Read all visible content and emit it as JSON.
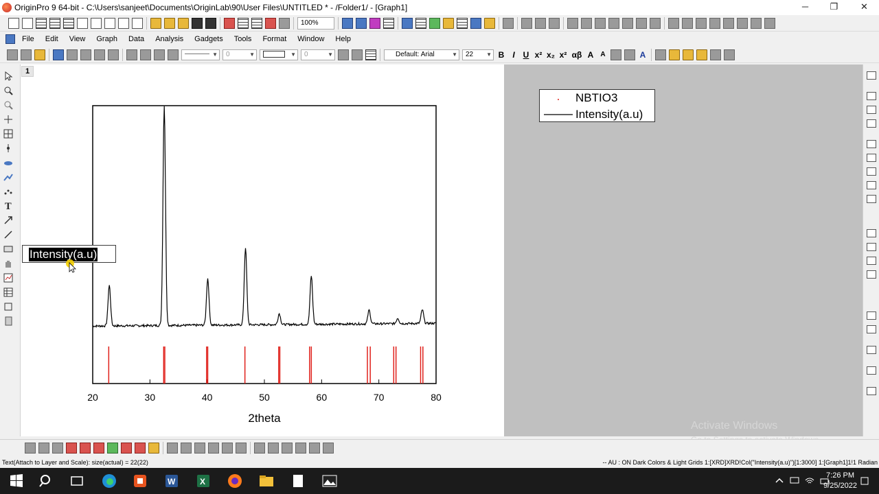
{
  "window": {
    "title": "OriginPro 9 64-bit - C:\\Users\\sanjeet\\Documents\\OriginLab\\90\\User Files\\UNTITLED * - /Folder1/ - [Graph1]",
    "minimize": "─",
    "maximize": "❐",
    "close": "✕"
  },
  "toolbar": {
    "zoom": "100%"
  },
  "menu": [
    "File",
    "Edit",
    "View",
    "Graph",
    "Data",
    "Analysis",
    "Gadgets",
    "Tools",
    "Format",
    "Window",
    "Help"
  ],
  "format_toolbar": {
    "line_width": "0",
    "fill_width": "0",
    "font": "Default: Arial",
    "font_size": "22",
    "bold": "B",
    "italic": "I",
    "underline": "U",
    "greek": "αβ"
  },
  "graph": {
    "layer": "1",
    "y_label_text": "Intensity(a.u)",
    "legend": {
      "entries": [
        "NBTIO3",
        "Intensity(a.u)"
      ]
    }
  },
  "chart_data": {
    "type": "line",
    "xlabel": "2theta",
    "ylabel": "Intensity(a.u)",
    "xlim": [
      20,
      80
    ],
    "xticks": [
      "20",
      "30",
      "40",
      "50",
      "60",
      "70",
      "80"
    ],
    "series": [
      {
        "name": "Intensity(a.u)",
        "color": "#000000",
        "peaks": [
          {
            "x": 22.9,
            "height": 0.148
          },
          {
            "x": 32.5,
            "height": 0.8
          },
          {
            "x": 40.1,
            "height": 0.17
          },
          {
            "x": 46.7,
            "height": 0.282
          },
          {
            "x": 52.6,
            "height": 0.04
          },
          {
            "x": 58.2,
            "height": 0.177
          },
          {
            "x": 68.3,
            "height": 0.05
          },
          {
            "x": 73.3,
            "height": 0.02
          },
          {
            "x": 77.6,
            "height": 0.05
          }
        ]
      },
      {
        "name": "NBTIO3",
        "color": "#e0201a",
        "sticks": [
          22.8,
          32.4,
          32.6,
          39.9,
          40.1,
          46.6,
          52.5,
          52.7,
          57.9,
          58.2,
          68.0,
          68.5,
          72.6,
          73.0,
          77.3,
          77.7
        ]
      }
    ]
  },
  "status": {
    "left": "Text(Attach to Layer and Scale): size(actual) = 22(22)",
    "right": "-- AU : ON  Dark Colors & Light Grids  1:[XRD]XRD!Col(\"Intensity(a.u)\")[1:3000]  1:[Graph1]1!1  Radian"
  },
  "watermark": {
    "line1": "Activate Windows",
    "line2": "Go to Settings to activate Windows."
  },
  "taskbar": {
    "time": "7:26 PM",
    "date": "9/25/2022"
  },
  "colors": {
    "canvas_gray": "#c0c0c0",
    "stick_red": "#e0201a"
  }
}
